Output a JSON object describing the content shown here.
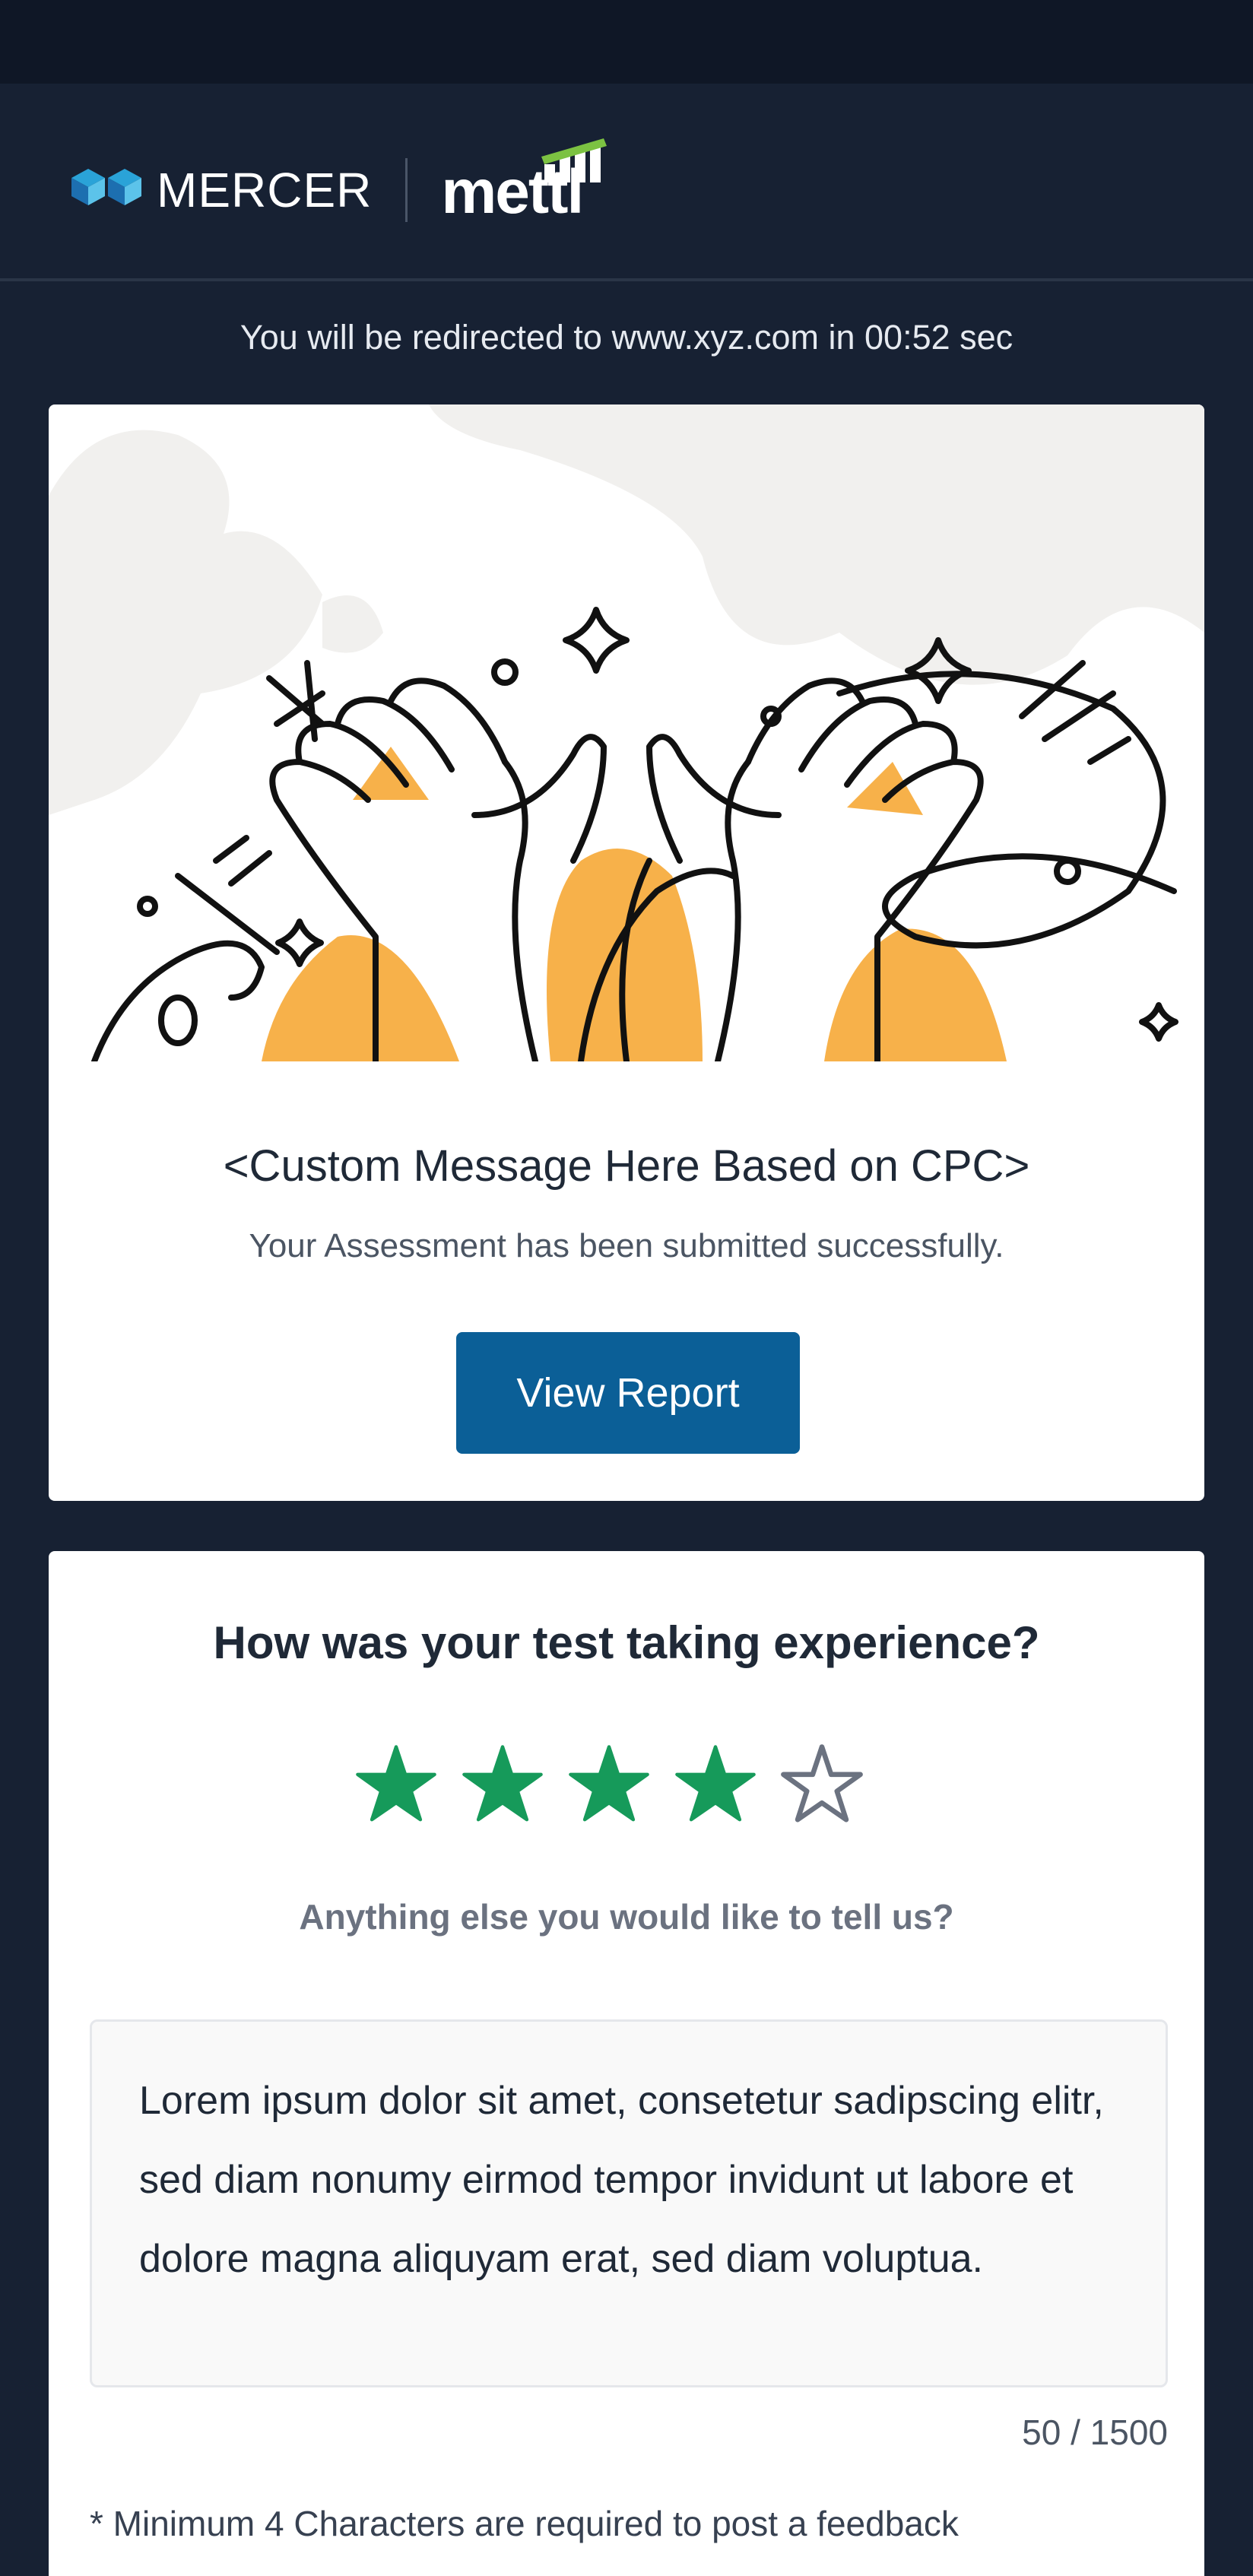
{
  "header": {
    "brand_primary": "MERCER",
    "brand_secondary": "mettl"
  },
  "redirect": {
    "text": "You will be redirected to www.xyz.com in 00:52 sec"
  },
  "success_card": {
    "custom_message": "<Custom Message Here Based on CPC>",
    "submitted_message": "Your Assessment has been submitted successfully.",
    "view_report_label": "View Report",
    "illustration": "high-five-hands-illustration"
  },
  "feedback": {
    "question": "How was your test taking experience?",
    "rating": 4,
    "rating_max": 5,
    "prompt": "Anything else you would like to tell us?",
    "text_value": "Lorem ipsum dolor sit amet, consetetur sadipscing elitr, sed diam nonumy eirmod tempor invidunt ut labore et dolore magna aliquyam erat, sed diam voluptua.",
    "char_count": "50 / 1500",
    "min_note": "* Minimum 4 Characters are required to post a feedback"
  },
  "colors": {
    "page_background": "#172133",
    "status_bar": "#0f1726",
    "button_primary": "#0b5f97",
    "star_filled": "#169a5a",
    "star_empty": "#6b7280",
    "accent_orange": "#f7b14a",
    "mettl_green": "#7cc242"
  }
}
